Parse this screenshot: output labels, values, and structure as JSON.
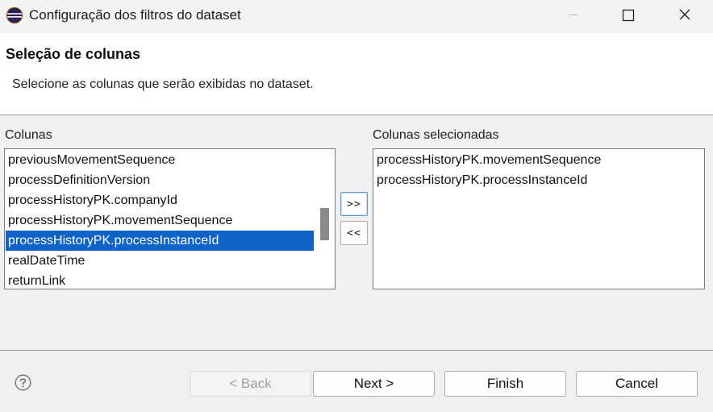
{
  "window": {
    "title": "Configuração dos filtros do dataset",
    "icon": "eclipse-icon"
  },
  "header": {
    "title": "Seleção de colunas",
    "description": "Selecione as colunas que serão exibidas no dataset."
  },
  "available": {
    "label": "Colunas",
    "items": [
      "previousMovementSequence",
      "processDefinitionVersion",
      "processHistoryPK.companyId",
      "processHistoryPK.movementSequence",
      "processHistoryPK.processInstanceId",
      "realDateTime",
      "returnLink"
    ],
    "selected_item": "processHistoryPK.processInstanceId"
  },
  "selected": {
    "label": "Colunas selecionadas",
    "items": [
      "processHistoryPK.movementSequence",
      "processHistoryPK.processInstanceId"
    ]
  },
  "transfer": {
    "add_label": ">>",
    "remove_label": "<<"
  },
  "footer": {
    "back_label": "< Back",
    "next_label": "Next >",
    "finish_label": "Finish",
    "cancel_label": "Cancel",
    "help_icon": "help-icon"
  },
  "colors": {
    "selection": "#0f63c7",
    "header_bg": "#ffffff",
    "dialog_bg": "#f0f0f0"
  }
}
